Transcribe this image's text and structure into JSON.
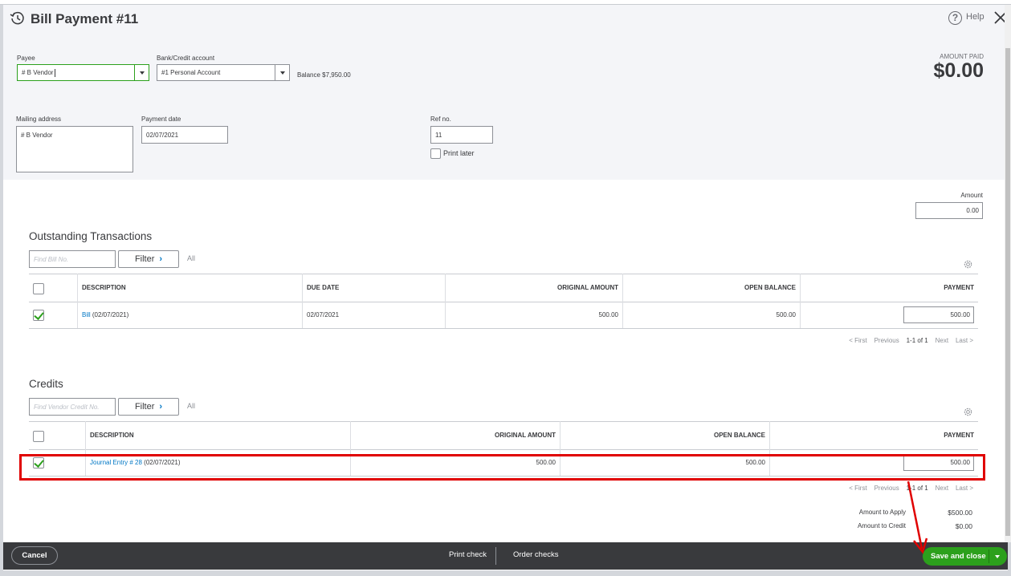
{
  "header": {
    "title": "Bill Payment #11",
    "help_label": "Help",
    "amount_paid_label": "AMOUNT PAID",
    "amount_paid_value": "$0.00"
  },
  "form": {
    "payee_label": "Payee",
    "payee_value": "# B Vendor",
    "bank_label": "Bank/Credit account",
    "bank_value": "#1 Personal Account",
    "balance_text": "Balance $7,950.00",
    "mailing_label": "Mailing address",
    "mailing_value": "# B Vendor",
    "payment_date_label": "Payment date",
    "payment_date_value": "02/07/2021",
    "ref_label": "Ref no.",
    "ref_value": "11",
    "print_later_label": "Print later",
    "print_later_checked": false,
    "amount_label": "Amount",
    "amount_value": "0.00"
  },
  "outstanding": {
    "title": "Outstanding Transactions",
    "find_placeholder": "Find Bill No.",
    "filter_label": "Filter",
    "filter_state": "All",
    "columns": [
      "DESCRIPTION",
      "DUE DATE",
      "ORIGINAL AMOUNT",
      "OPEN BALANCE",
      "PAYMENT"
    ],
    "rows": [
      {
        "checked": true,
        "desc_link": "Bill",
        "desc_rest": " (02/07/2021)",
        "due_date": "02/07/2021",
        "original": "500.00",
        "open": "500.00",
        "payment": "500.00"
      }
    ],
    "pager": {
      "first": "< First",
      "previous": "Previous",
      "range": "1-1 of 1",
      "next": "Next",
      "last": "Last >"
    }
  },
  "credits": {
    "title": "Credits",
    "find_placeholder": "Find Vendor Credit No.",
    "filter_label": "Filter",
    "filter_state": "All",
    "columns": [
      "DESCRIPTION",
      "ORIGINAL AMOUNT",
      "OPEN BALANCE",
      "PAYMENT"
    ],
    "rows": [
      {
        "checked": true,
        "desc_link": "Journal Entry # 28",
        "desc_rest": " (02/07/2021)",
        "original": "500.00",
        "open": "500.00",
        "payment": "500.00"
      }
    ],
    "pager": {
      "first": "< First",
      "previous": "Previous",
      "range": "1-1 of 1",
      "next": "Next",
      "last": "Last >"
    }
  },
  "summary": {
    "apply_label": "Amount to Apply",
    "apply_value": "$500.00",
    "credit_label": "Amount to Credit",
    "credit_value": "$0.00"
  },
  "footer": {
    "cancel_label": "Cancel",
    "print_check_label": "Print check",
    "order_checks_label": "Order checks",
    "save_label": "Save and close"
  },
  "colors": {
    "accent_green": "#2ca01c",
    "link_blue": "#0077c5",
    "footer_bg": "#393a3d",
    "annotation_red": "#e00000"
  }
}
